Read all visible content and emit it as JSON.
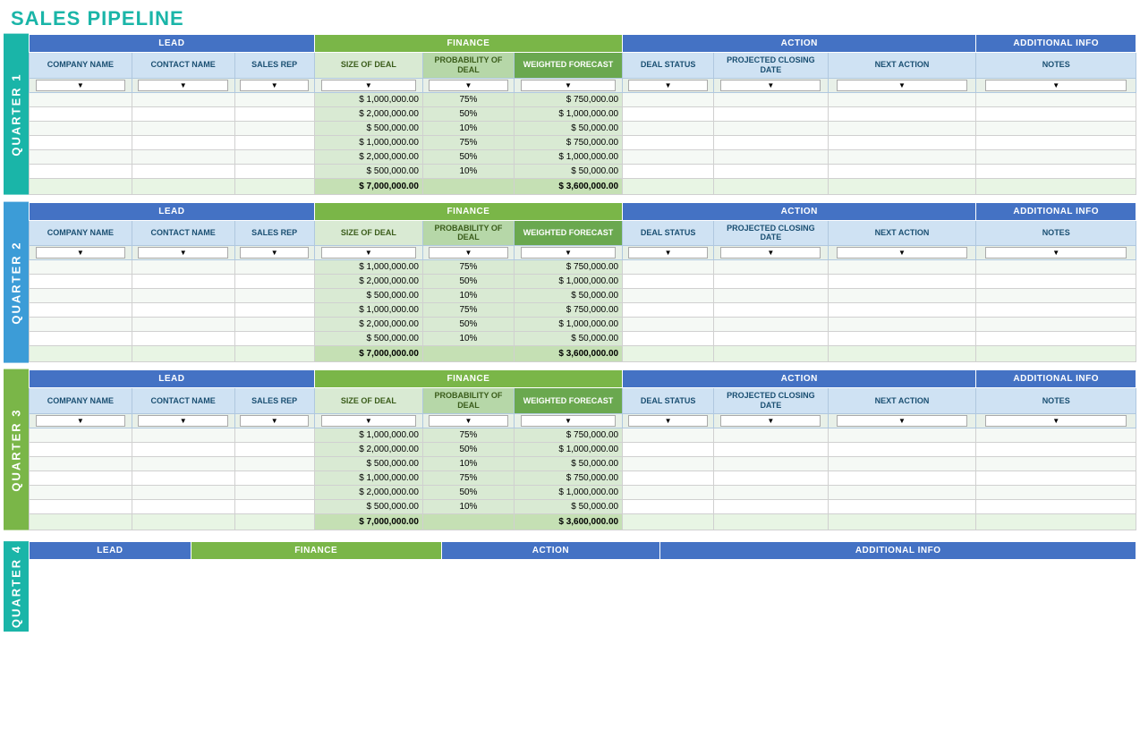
{
  "page": {
    "title": "SALES PIPELINE"
  },
  "sections": {
    "header_lead": "LEAD",
    "header_finance": "FINANCE",
    "header_action": "ACTION",
    "header_additional": "ADDITIONAL INFO",
    "col_company": "COMPANY NAME",
    "col_contact": "CONTACT NAME",
    "col_salesrep": "SALES REP",
    "col_size": "SIZE OF DEAL",
    "col_prob": "PROBABILITY OF DEAL",
    "col_wf": "WEIGHTED FORECAST",
    "col_dealstatus": "DEAL STATUS",
    "col_projected": "PROJECTED CLOSING DATE",
    "col_nextaction": "NEXT ACTION",
    "col_notes": "NOTES",
    "filter_placeholder": "▼",
    "dollar_sign": "$"
  },
  "quarters": [
    {
      "label": "QUARTER 1",
      "color_class": "q1-color",
      "rows": [
        {
          "size": "1,000,000.00",
          "prob": "75%",
          "wf": "750,000.00"
        },
        {
          "size": "2,000,000.00",
          "prob": "50%",
          "wf": "1,000,000.00"
        },
        {
          "size": "500,000.00",
          "prob": "10%",
          "wf": "50,000.00"
        },
        {
          "size": "1,000,000.00",
          "prob": "75%",
          "wf": "750,000.00"
        },
        {
          "size": "2,000,000.00",
          "prob": "50%",
          "wf": "1,000,000.00"
        },
        {
          "size": "500,000.00",
          "prob": "10%",
          "wf": "50,000.00"
        }
      ],
      "total_size": "7,000,000.00",
      "total_wf": "3,600,000.00"
    },
    {
      "label": "QUARTER 2",
      "color_class": "q2-color",
      "rows": [
        {
          "size": "1,000,000.00",
          "prob": "75%",
          "wf": "750,000.00"
        },
        {
          "size": "2,000,000.00",
          "prob": "50%",
          "wf": "1,000,000.00"
        },
        {
          "size": "500,000.00",
          "prob": "10%",
          "wf": "50,000.00"
        },
        {
          "size": "1,000,000.00",
          "prob": "75%",
          "wf": "750,000.00"
        },
        {
          "size": "2,000,000.00",
          "prob": "50%",
          "wf": "1,000,000.00"
        },
        {
          "size": "500,000.00",
          "prob": "10%",
          "wf": "50,000.00"
        }
      ],
      "total_size": "7,000,000.00",
      "total_wf": "3,600,000.00"
    },
    {
      "label": "QUARTER 3",
      "color_class": "q3-color",
      "rows": [
        {
          "size": "1,000,000.00",
          "prob": "75%",
          "wf": "750,000.00"
        },
        {
          "size": "2,000,000.00",
          "prob": "50%",
          "wf": "1,000,000.00"
        },
        {
          "size": "500,000.00",
          "prob": "10%",
          "wf": "50,000.00"
        },
        {
          "size": "1,000,000.00",
          "prob": "75%",
          "wf": "750,000.00"
        },
        {
          "size": "2,000,000.00",
          "prob": "50%",
          "wf": "1,000,000.00"
        },
        {
          "size": "500,000.00",
          "prob": "10%",
          "wf": "50,000.00"
        }
      ],
      "total_size": "7,000,000.00",
      "total_wf": "3,600,000.00"
    }
  ],
  "quarter4_label": "QUARTER 4",
  "quarter4_color": "q1-color"
}
